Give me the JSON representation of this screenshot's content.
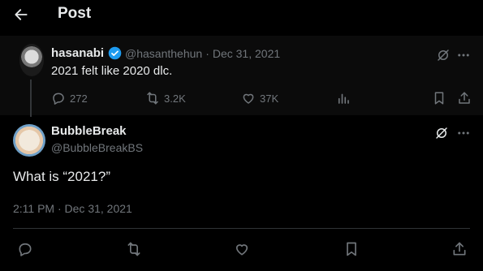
{
  "header": {
    "title": "Post",
    "back_icon": "arrow-left-icon"
  },
  "quoted_post": {
    "name": "hasanabi",
    "handle": "@hasanthehun",
    "date": "Dec 31, 2021",
    "text": "2021 felt like 2020 dlc.",
    "replies": "272",
    "reposts": "3.2K",
    "likes": "37K"
  },
  "main_post": {
    "name": "BubbleBreak",
    "handle": "@BubbleBreakBS",
    "text": "What is “2021?”",
    "timestamp": "2:11 PM · Dec 31, 2021"
  },
  "colors": {
    "background": "#000000",
    "text": "#e7e9ea",
    "muted": "#71767b",
    "verified": "#1d9bf0"
  }
}
